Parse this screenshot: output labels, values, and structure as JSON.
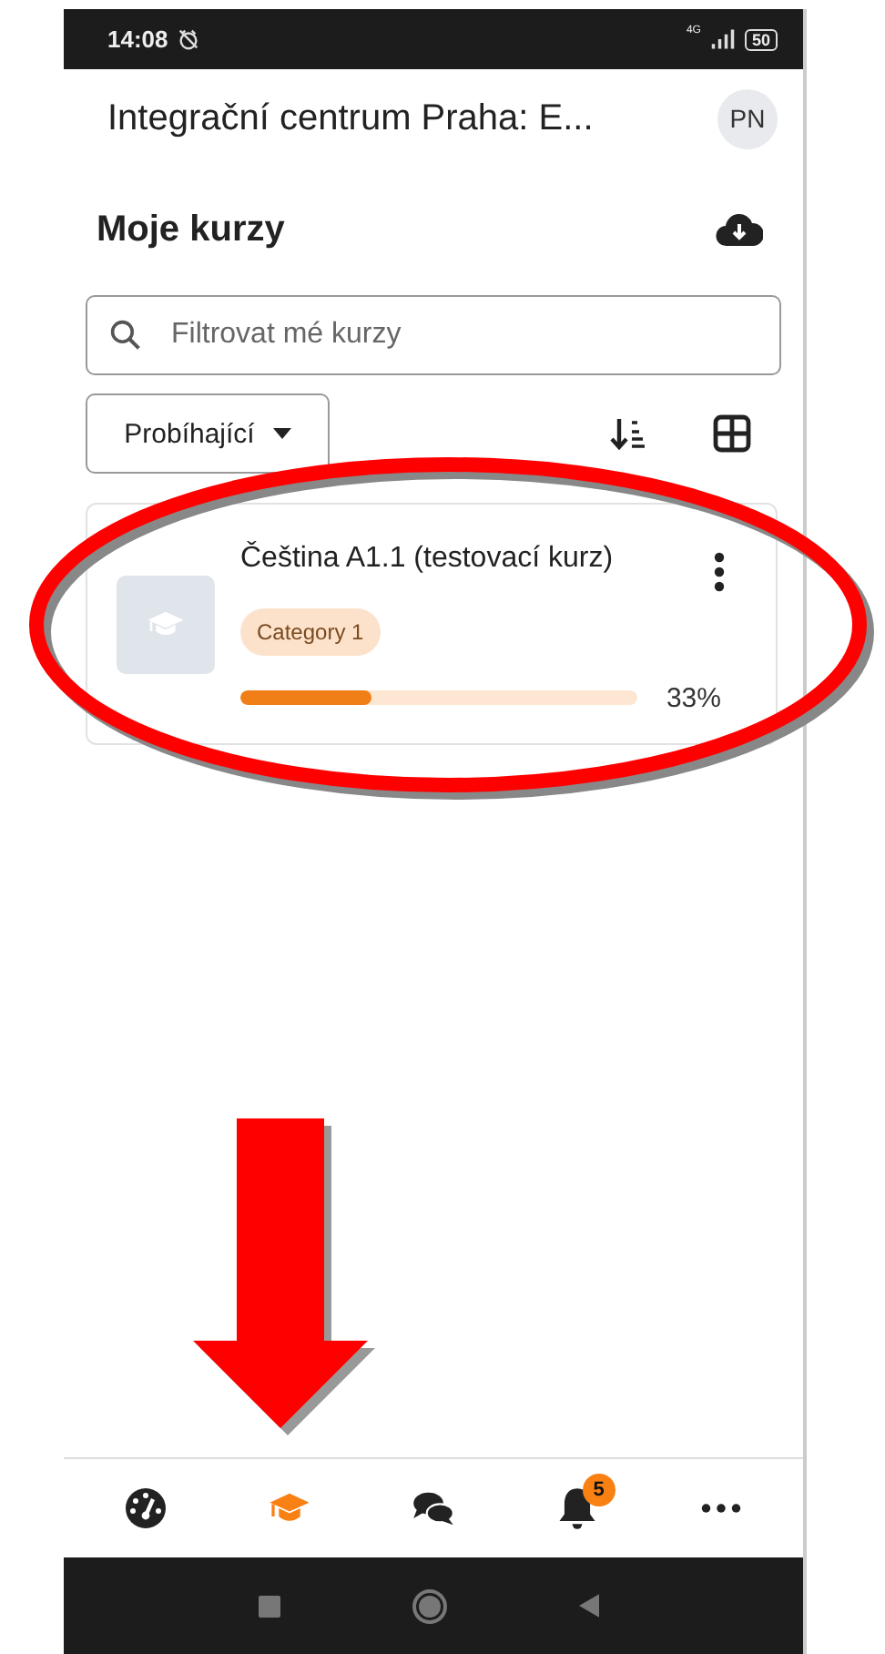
{
  "status_bar": {
    "time": "14:08",
    "network": "4G",
    "battery": "50"
  },
  "header": {
    "title": "Integrační centrum Praha: E...",
    "avatar": "PN"
  },
  "page_title": "Moje kurzy",
  "search": {
    "placeholder": "Filtrovat mé kurzy"
  },
  "filter": {
    "value": "Probíhající"
  },
  "courses": [
    {
      "title": "Čeština A1.1 (testovací kurz)",
      "category": "Category 1",
      "level": 0.33,
      "progress": "33%"
    }
  ],
  "bottom_nav": [
    {
      "kind": "dashboard",
      "selected": false
    },
    {
      "kind": "courses",
      "selected": true
    },
    {
      "kind": "messages",
      "selected": false
    },
    {
      "kind": "notifications",
      "selected": false,
      "badge": "5"
    },
    {
      "kind": "more",
      "selected": false
    }
  ],
  "annotations": {
    "highlight_ellipse": true,
    "arrow": true
  }
}
